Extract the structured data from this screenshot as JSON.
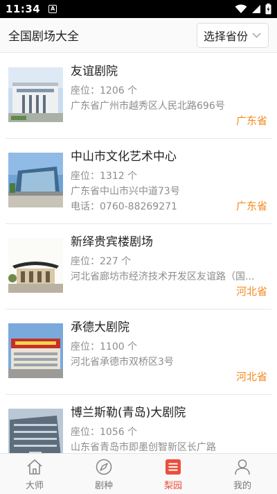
{
  "status_bar": {
    "time": "11:34",
    "notification_badge": "A"
  },
  "header": {
    "title": "全国剧场大全",
    "province_select_label": "选择省份"
  },
  "theaters": [
    {
      "name": "友谊剧院",
      "seats": "座位：1206 个",
      "address": "广东省广州市越秀区人民北路696号",
      "phone": "",
      "province": "广东省"
    },
    {
      "name": "中山市文化艺术中心",
      "seats": "座位：1312 个",
      "address": "广东省中山市兴中道73号",
      "phone": "电话：0760-88269271",
      "province": "广东省"
    },
    {
      "name": "新绎贵宾楼剧场",
      "seats": "座位：227 个",
      "address": "河北省廊坊市经济技术开发区友谊路（国...",
      "phone": "",
      "province": "河北省"
    },
    {
      "name": "承德大剧院",
      "seats": "座位：1100 个",
      "address": "河北省承德市双桥区3号",
      "phone": "",
      "province": "河北省"
    },
    {
      "name": "博兰斯勒(青岛)大剧院",
      "seats": "座位：1056 个",
      "address": "山东省青岛市即墨创智新区长广路",
      "phone": "",
      "province": ""
    }
  ],
  "tabs": [
    {
      "label": "大师",
      "icon": "home-icon"
    },
    {
      "label": "剧种",
      "icon": "compass-icon"
    },
    {
      "label": "梨园",
      "icon": "list-icon"
    },
    {
      "label": "我的",
      "icon": "user-icon"
    }
  ],
  "colors": {
    "accent": "#f28a1c",
    "active_tab": "#ec4f3b",
    "muted_text": "#8c8c8c"
  }
}
